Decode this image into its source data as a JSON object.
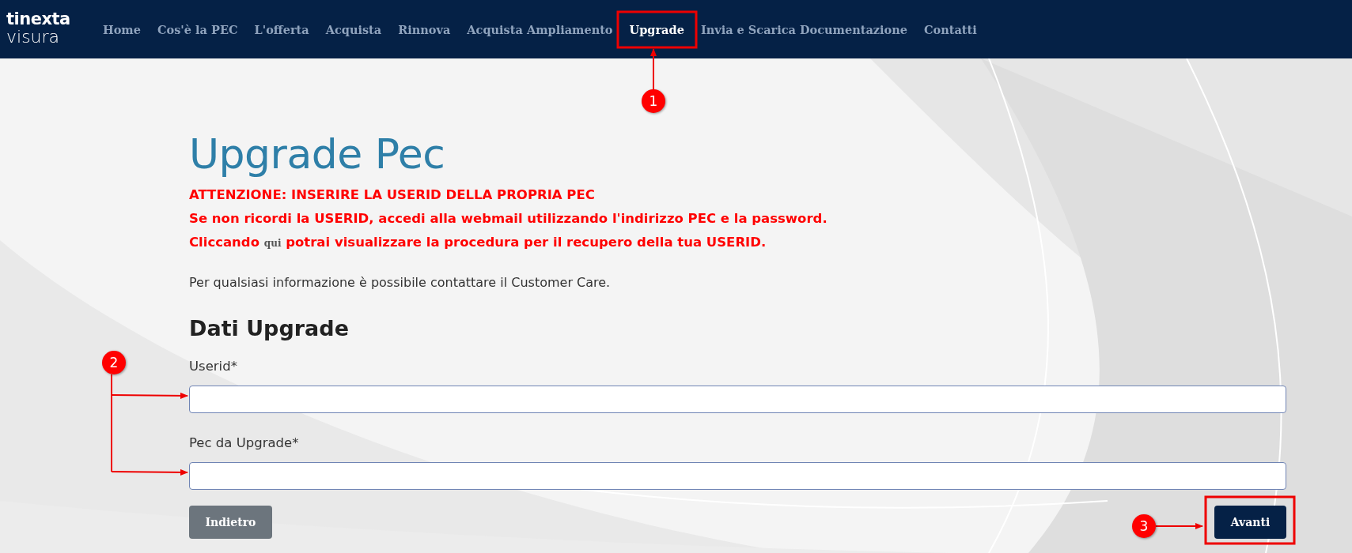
{
  "header": {
    "logo": {
      "brand": "tinexta",
      "product": "visura"
    },
    "nav": [
      {
        "label": "Home",
        "selected": false
      },
      {
        "label": "Cos'è la PEC",
        "selected": false
      },
      {
        "label": "L'offerta",
        "selected": false
      },
      {
        "label": "Acquista",
        "selected": false
      },
      {
        "label": "Rinnova",
        "selected": false
      },
      {
        "label": "Acquista Ampliamento",
        "selected": false
      },
      {
        "label": "Upgrade",
        "selected": true
      },
      {
        "label": "Invia e Scarica Documentazione",
        "selected": false
      },
      {
        "label": "Contatti",
        "selected": false
      }
    ]
  },
  "form": {
    "title": "Upgrade Pec",
    "warnings": [
      {
        "text": "ATTENZIONE: INSERIRE LA USERID DELLA PROPRIA PEC"
      },
      {
        "text": "Se non ricordi la USERID, accedi alla webmail utilizzando l'indirizzo PEC e la password."
      },
      {
        "text": "Cliccando",
        "link": "qui",
        "after": "potrai visualizzare la procedura per il recupero della tua USERID."
      }
    ],
    "info": "Per qualsiasi informazione è possibile contattare il Customer Care.",
    "section_title": "Dati Upgrade",
    "fields": [
      {
        "label": "Userid*"
      },
      {
        "label": "Pec da Upgrade*"
      }
    ],
    "buttons": [
      {
        "label": "Indietro",
        "kind": "secondary"
      },
      {
        "label": "Avanti",
        "kind": "primary"
      }
    ]
  },
  "annotations": [
    {
      "number": "1"
    },
    {
      "number": "2"
    },
    {
      "number": "3"
    }
  ]
}
